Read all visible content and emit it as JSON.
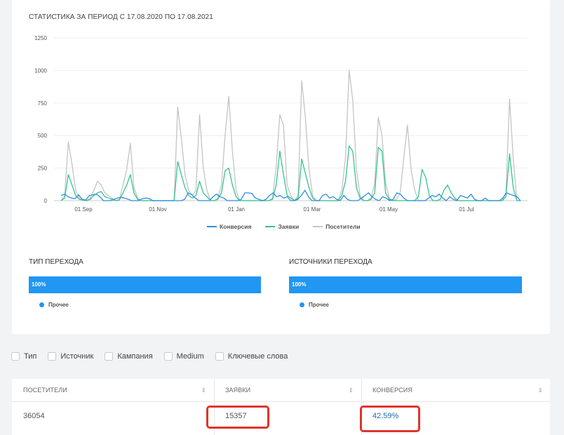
{
  "stats": {
    "title": "СТАТИСТИКА ЗА ПЕРИОД С 17.08.2020 ПО 17.08.2021"
  },
  "chart_data": {
    "type": "line",
    "yticks": [
      0,
      250,
      500,
      750,
      1000,
      1250
    ],
    "ylim": [
      0,
      1250
    ],
    "xticks": [
      "01 Sep",
      "01 Nov",
      "01 Jan",
      "01 Mar",
      "01 May",
      "01 Jul"
    ],
    "series": [
      {
        "name": "Конверсия",
        "color": "#2f8ee0",
        "values": [
          40,
          50,
          30,
          20,
          15,
          45,
          10,
          5,
          40,
          45,
          50,
          30,
          0,
          0,
          0,
          10,
          20,
          25,
          20,
          10,
          0,
          0,
          0,
          15,
          20,
          15,
          0,
          0,
          0,
          0,
          0,
          0,
          0,
          0,
          0,
          10,
          60,
          45,
          20,
          0,
          0,
          0,
          0,
          30,
          50,
          30,
          20,
          0,
          0,
          0,
          0,
          10,
          60,
          60,
          55,
          20,
          10,
          0,
          10,
          40,
          60,
          30,
          40,
          20,
          30,
          0,
          0,
          10,
          40,
          80,
          30,
          0,
          0,
          0,
          40,
          50,
          20,
          30,
          10,
          0,
          40,
          10,
          0,
          0,
          0,
          20,
          40,
          60,
          30,
          10,
          0,
          30,
          20,
          0,
          10,
          60,
          50,
          20,
          0,
          0,
          0,
          0,
          0,
          0,
          20,
          40,
          30,
          50,
          20,
          0,
          30,
          10,
          0,
          40,
          30,
          20,
          50,
          10,
          0,
          0,
          20,
          0,
          0,
          0,
          0,
          20,
          60,
          50,
          40,
          30,
          0
        ]
      },
      {
        "name": "Заявки",
        "color": "#34c38f",
        "values": [
          0,
          20,
          200,
          120,
          40,
          10,
          5,
          0,
          10,
          40,
          60,
          70,
          30,
          20,
          10,
          0,
          5,
          60,
          120,
          200,
          60,
          10,
          0,
          0,
          0,
          0,
          0,
          0,
          0,
          0,
          0,
          0,
          300,
          200,
          100,
          40,
          20,
          40,
          150,
          60,
          30,
          0,
          0,
          10,
          60,
          230,
          250,
          120,
          30,
          0,
          0,
          0,
          0,
          0,
          0,
          0,
          0,
          0,
          10,
          120,
          380,
          200,
          40,
          20,
          0,
          20,
          320,
          210,
          100,
          20,
          0,
          0,
          0,
          0,
          0,
          0,
          0,
          40,
          150,
          420,
          380,
          100,
          20,
          0,
          0,
          10,
          60,
          410,
          380,
          60,
          10,
          0,
          0,
          0,
          0,
          0,
          0,
          0,
          30,
          240,
          180,
          40,
          0,
          0,
          10,
          80,
          120,
          60,
          20,
          0,
          0,
          0,
          0,
          0,
          0,
          0,
          0,
          0,
          0,
          0,
          0,
          0,
          30,
          360,
          100,
          0,
          0
        ]
      },
      {
        "name": "Посетители",
        "color": "#c4c4c4",
        "values": [
          0,
          40,
          450,
          280,
          80,
          20,
          10,
          0,
          20,
          80,
          150,
          120,
          60,
          40,
          20,
          0,
          10,
          120,
          240,
          440,
          100,
          20,
          0,
          0,
          0,
          0,
          0,
          0,
          0,
          0,
          0,
          0,
          720,
          480,
          200,
          80,
          40,
          80,
          660,
          260,
          80,
          0,
          0,
          20,
          120,
          500,
          800,
          380,
          80,
          0,
          0,
          0,
          0,
          0,
          0,
          0,
          0,
          0,
          20,
          260,
          660,
          580,
          120,
          40,
          0,
          40,
          920,
          640,
          240,
          40,
          0,
          0,
          0,
          0,
          0,
          0,
          0,
          80,
          330,
          1000,
          770,
          240,
          40,
          0,
          0,
          20,
          130,
          640,
          500,
          140,
          20,
          0,
          10,
          60,
          330,
          580,
          240,
          80,
          0,
          0,
          0,
          0,
          0,
          0,
          0,
          0,
          0,
          0,
          0,
          0,
          0,
          0,
          0,
          0,
          0,
          0,
          0,
          0,
          0,
          0,
          0,
          0,
          60,
          780,
          330,
          0,
          0
        ]
      }
    ]
  },
  "legend": {
    "conversion": "Конверсия",
    "requests": "Заявки",
    "visitors": "Посетители"
  },
  "transition_type": {
    "title": "ТИП ПЕРЕХОДА",
    "bar_label": "100%",
    "bar_value_pct": 100,
    "legend_label": "Прочее"
  },
  "transition_sources": {
    "title": "ИСТОЧНИКИ ПЕРЕХОДА",
    "bar_label": "100%",
    "bar_value_pct": 100,
    "legend_label": "Прочее"
  },
  "filters": [
    {
      "label": "Тип"
    },
    {
      "label": "Источник"
    },
    {
      "label": "Кампания"
    },
    {
      "label": "Medium"
    },
    {
      "label": "Ключевые слова"
    }
  ],
  "table": {
    "headers": [
      "ПОСЕТИТЕЛИ",
      "ЗАЯВКИ",
      "КОНВЕРСИЯ"
    ],
    "row": [
      "36054",
      "15357",
      "42.59%"
    ]
  },
  "colors": {
    "accent": "#2196f3",
    "highlight": "#e0342c"
  }
}
